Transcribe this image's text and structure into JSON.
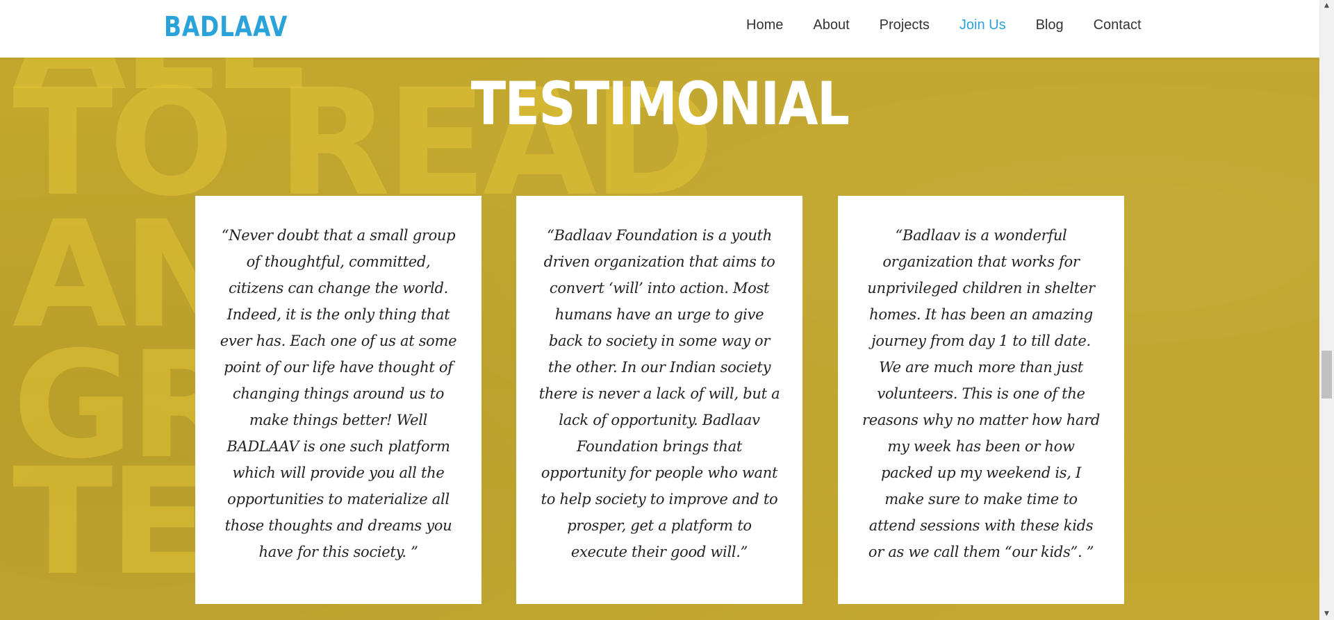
{
  "header": {
    "logo": "BADLAAV",
    "nav": [
      {
        "label": "Home"
      },
      {
        "label": "About"
      },
      {
        "label": "Projects"
      },
      {
        "label": "Join Us"
      },
      {
        "label": "Blog"
      },
      {
        "label": "Contact"
      }
    ],
    "active_nav": "Join Us"
  },
  "background_text": [
    "TO READ",
    "AN",
    "GR",
    "TE"
  ],
  "section": {
    "title": "TESTIMONIAL"
  },
  "testimonials": [
    {
      "quote": "“Never doubt that a small group of thoughtful, committed, citizens can change the world. Indeed, it is the only thing that ever has. Each one of us at some point of our life have thought of changing things around us to make things better! Well BADLAAV is one such platform which will provide you all the opportunities to materialize all those thoughts and dreams you have for this society. ”"
    },
    {
      "quote": "“Badlaav Foundation is a youth driven organization that aims to convert ‘will’ into action. Most humans have an urge to give back to society in some way or the other. In our Indian society there is never a lack of will, but a lack of opportunity. Badlaav Foundation brings that opportunity for people who want to help society to improve and to prosper, get a platform to execute their good will.”"
    },
    {
      "quote": "“Badlaav is a wonderful organization that works for unprivileged children in shelter homes. It has been an amazing journey from day 1 to till date. We are much more than just volunteers. This is one of the reasons why no matter how hard my week has been or how packed up my weekend is, I make sure to make time to attend sessions with these kids or as we call them “our kids”. ”"
    }
  ],
  "colors": {
    "brand": "#2aa2da",
    "section_bg": "#c2a72e",
    "card_bg": "#ffffff",
    "title": "#ffffff"
  },
  "icons": {
    "scroll_up": "triangle-up-icon",
    "scroll_down": "triangle-down-icon"
  }
}
